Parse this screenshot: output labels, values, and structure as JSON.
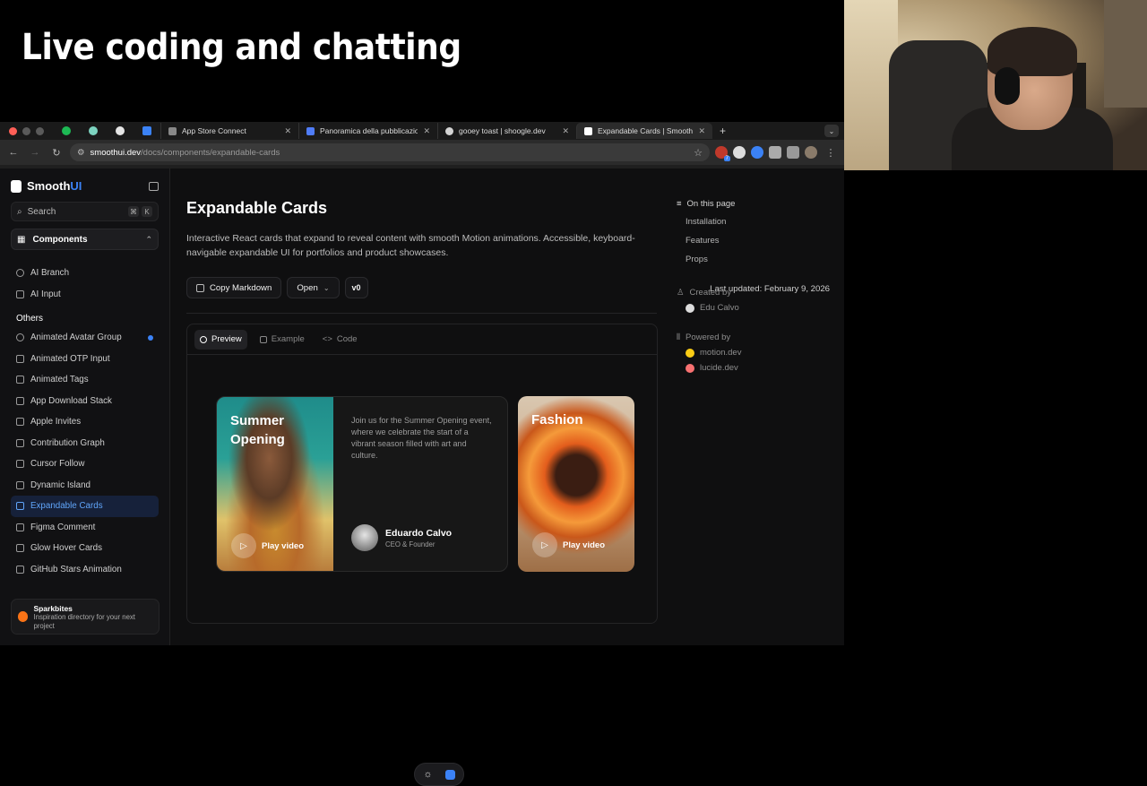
{
  "stream": {
    "title": "Live coding and chatting"
  },
  "browser": {
    "tabs": [
      {
        "label": "App Store Connect",
        "color": "#888888"
      },
      {
        "label": "Panoramica della pubblicazio",
        "color": "#4f7cf7"
      },
      {
        "label": "gooey toast | shoogle.dev",
        "color": "#d4d4d4"
      },
      {
        "label": "Expandable Cards | SmoothUI",
        "color": "#ffffff"
      }
    ],
    "url_host": "smoothui.dev",
    "url_path": "/docs/components/expandable-cards",
    "ext_badge": "7"
  },
  "sidebar": {
    "brand_main": "Smooth",
    "brand_accent": "UI",
    "search_placeholder": "Search",
    "kbd_cmd": "⌘",
    "kbd_k": "K",
    "components_label": "Components",
    "top_items": [
      "AI Branch",
      "AI Input"
    ],
    "section_label": "Others",
    "items": [
      "Animated Avatar Group",
      "Animated OTP Input",
      "Animated Tags",
      "App Download Stack",
      "Apple Invites",
      "Contribution Graph",
      "Cursor Follow",
      "Dynamic Island",
      "Expandable Cards",
      "Figma Comment",
      "Glow Hover Cards",
      "GitHub Stars Animation"
    ],
    "active_item": "Expandable Cards",
    "promo_title": "Sparkbites",
    "promo_text": "Inspiration directory for your next project"
  },
  "main": {
    "title": "Expandable Cards",
    "description": "Interactive React cards that expand to reveal content with smooth Motion animations. Accessible, keyboard-navigable expandable UI for portfolios and product showcases.",
    "copy_markdown": "Copy Markdown",
    "open_label": "Open",
    "last_updated": "Last updated: February 9, 2026",
    "preview_tabs": [
      "Preview",
      "Example",
      "Code"
    ],
    "card1": {
      "title": "Summer Opening",
      "text": "Join us for the Summer Opening event, where we celebrate the start of a vibrant season filled with art and culture.",
      "play": "Play video",
      "author_name": "Eduardo Calvo",
      "author_role": "CEO & Founder"
    },
    "card2": {
      "title": "Fashion",
      "play": "Play video"
    }
  },
  "toc": {
    "heading": "On this page",
    "items": [
      "Installation",
      "Features",
      "Props"
    ],
    "created_by_label": "Created by",
    "created_by": "Edu Calvo",
    "powered_by_label": "Powered by",
    "powered": [
      "motion.dev",
      "lucide.dev"
    ]
  }
}
